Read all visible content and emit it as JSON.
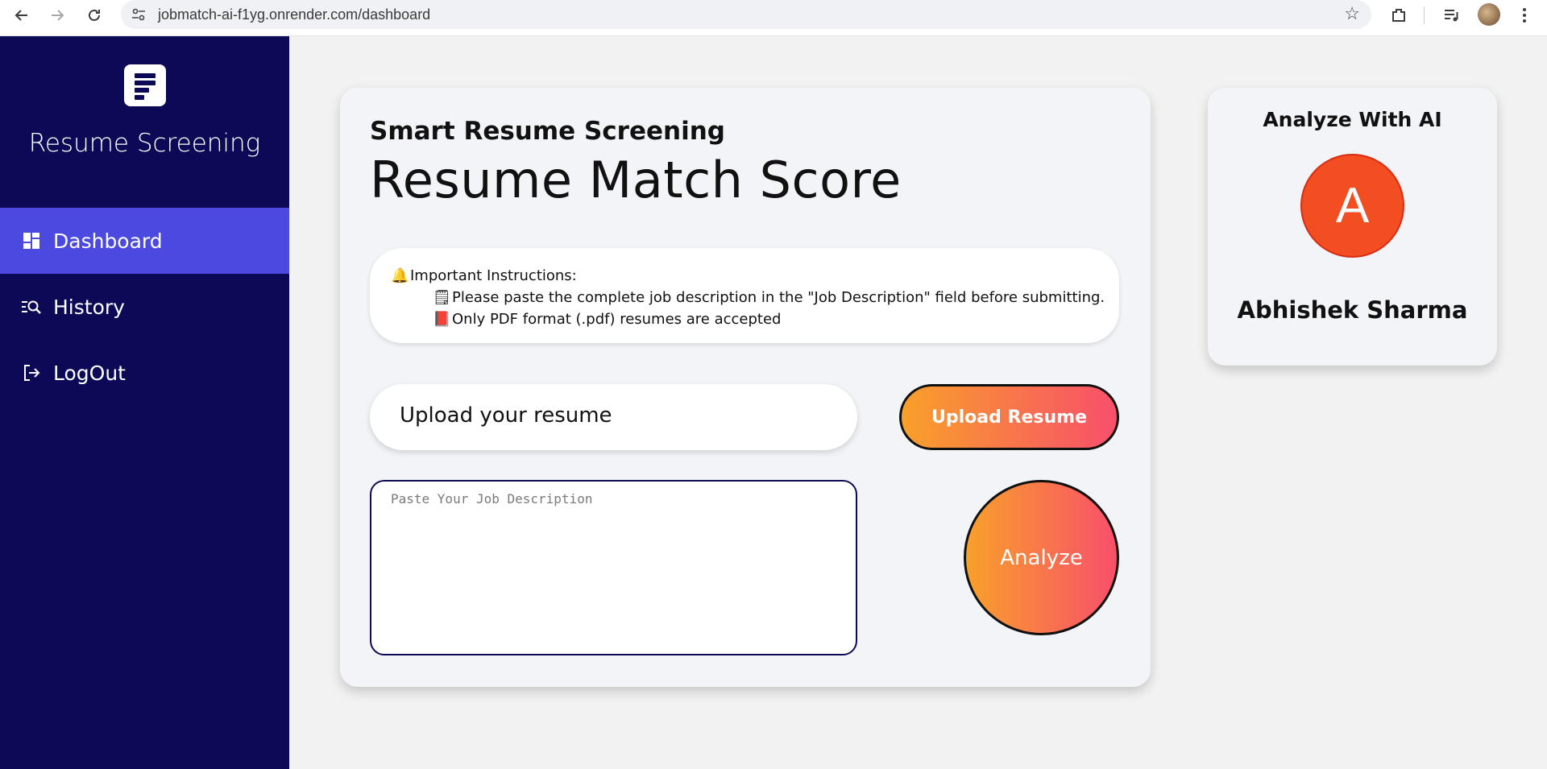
{
  "browser": {
    "url": "jobmatch-ai-f1yg.onrender.com/dashboard",
    "icons": [
      "back-arrow-icon",
      "forward-arrow-icon",
      "reload-icon",
      "site-info-icon",
      "bookmark-star-icon",
      "extensions-icon",
      "media-controls-icon",
      "profile-avatar",
      "kebab-menu-icon"
    ]
  },
  "sidebar": {
    "brand": "Resume Screening",
    "items": [
      {
        "label": "Dashboard",
        "icon": "dashboard-icon",
        "active": true
      },
      {
        "label": "History",
        "icon": "history-search-icon",
        "active": false
      },
      {
        "label": "LogOut",
        "icon": "logout-icon",
        "active": false
      }
    ]
  },
  "main": {
    "subtitle": "Smart Resume Screening",
    "title": "Resume Match Score",
    "instructions": {
      "heading": "Important Instructions:",
      "heading_icon": "🔔",
      "lines": [
        {
          "icon": "🗒",
          "text": "Please paste the complete job description in the \"Job Description\" field before submitting."
        },
        {
          "icon": "📕",
          "text": "Only PDF format (.pdf) resumes are accepted"
        }
      ]
    },
    "upload_field_label": "Upload your resume",
    "upload_button": "Upload Resume",
    "job_description_placeholder": "Paste Your Job Description",
    "analyze_button": "Analyze"
  },
  "profile": {
    "heading": "Analyze With AI",
    "avatar_letter": "A",
    "name": "Abhishek Sharma"
  },
  "colors": {
    "sidebar_bg": "#0c0a57",
    "sidebar_active": "#4b49df",
    "gradient_start": "#f9a02a",
    "gradient_end": "#f84f6b",
    "avatar_bg": "#f24e22"
  }
}
